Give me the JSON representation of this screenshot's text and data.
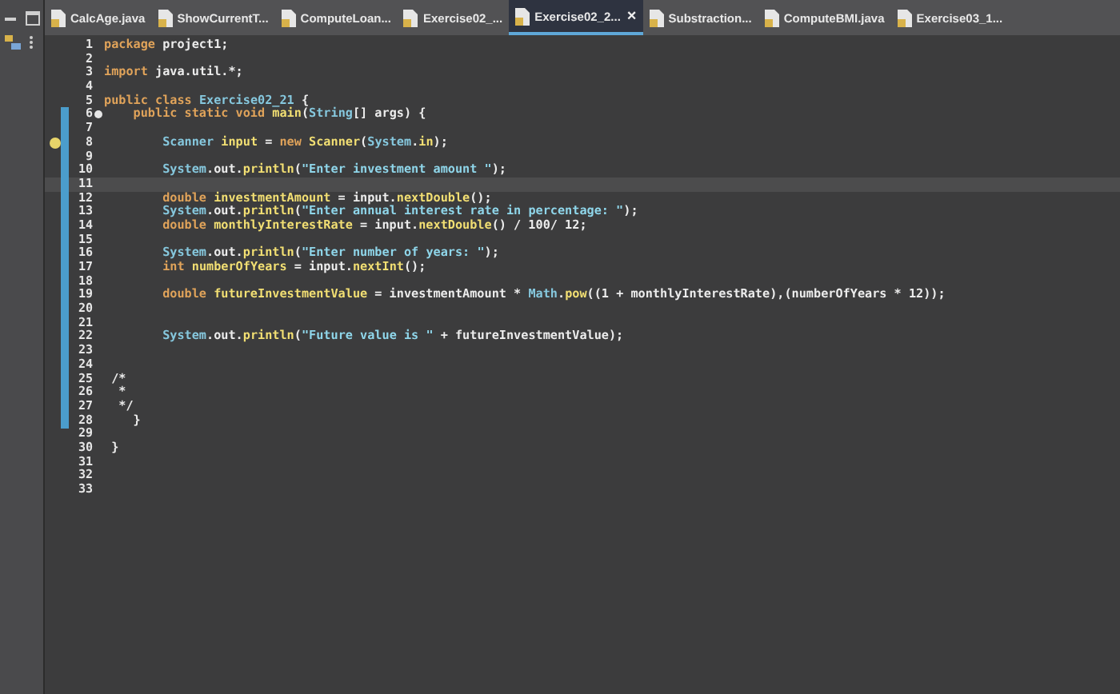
{
  "tabs": [
    {
      "label": "CalcAge.java",
      "selected": false
    },
    {
      "label": "ShowCurrentT...",
      "selected": false
    },
    {
      "label": "ComputeLoan...",
      "selected": false
    },
    {
      "label": "Exercise02_...",
      "selected": false
    },
    {
      "label": "Exercise02_2...",
      "selected": true,
      "close": "×"
    },
    {
      "label": "Substraction...",
      "selected": false
    },
    {
      "label": "ComputeBMI.java",
      "selected": false
    },
    {
      "label": "Exercise03_1...",
      "selected": false
    }
  ],
  "editor": {
    "lines": [
      {
        "number": "1",
        "tokens": [
          {
            "kind": "keyword",
            "text": "package "
          },
          {
            "kind": "plain",
            "text": "project1;"
          }
        ]
      },
      {
        "number": "2"
      },
      {
        "number": "3",
        "tokens": [
          {
            "kind": "keyword",
            "text": "import "
          },
          {
            "kind": "plain",
            "text": "java.util.*;"
          }
        ]
      },
      {
        "number": "4"
      },
      {
        "number": "5",
        "tokens": [
          {
            "kind": "keyword",
            "text": "public class "
          },
          {
            "kind": "type",
            "text": "Exercise02_21"
          },
          {
            "kind": "plain",
            "text": " {"
          }
        ]
      },
      {
        "number": "6",
        "fold": true,
        "tokens": [
          {
            "kind": "keyword",
            "text": "    public static void "
          },
          {
            "kind": "method",
            "text": "main"
          },
          {
            "kind": "plain",
            "text": "("
          },
          {
            "kind": "type",
            "text": "String"
          },
          {
            "kind": "plain",
            "text": "[] args) {"
          }
        ]
      },
      {
        "number": "7"
      },
      {
        "number": "8",
        "warning": true,
        "tokens": [
          {
            "kind": "type",
            "text": "        Scanner "
          },
          {
            "kind": "var",
            "text": "input"
          },
          {
            "kind": "plain",
            "text": " = "
          },
          {
            "kind": "keyword",
            "text": "new "
          },
          {
            "kind": "method",
            "text": "Scanner"
          },
          {
            "kind": "plain",
            "text": "("
          },
          {
            "kind": "type",
            "text": "System"
          },
          {
            "kind": "plain",
            "text": "."
          },
          {
            "kind": "var",
            "text": "in"
          },
          {
            "kind": "plain",
            "text": ");"
          }
        ]
      },
      {
        "number": "9"
      },
      {
        "number": "10",
        "tokens": [
          {
            "kind": "type",
            "text": "        System"
          },
          {
            "kind": "plain",
            "text": ".out."
          },
          {
            "kind": "method",
            "text": "println"
          },
          {
            "kind": "plain",
            "text": "("
          },
          {
            "kind": "string",
            "text": "\"Enter investment amount \""
          },
          {
            "kind": "plain",
            "text": ");"
          }
        ]
      },
      {
        "number": "11",
        "current": true
      },
      {
        "number": "12",
        "tokens": [
          {
            "kind": "keyword",
            "text": "        double "
          },
          {
            "kind": "var",
            "text": "investmentAmount"
          },
          {
            "kind": "plain",
            "text": " = input."
          },
          {
            "kind": "method",
            "text": "nextDouble"
          },
          {
            "kind": "plain",
            "text": "();"
          }
        ]
      },
      {
        "number": "13",
        "tokens": [
          {
            "kind": "type",
            "text": "        System"
          },
          {
            "kind": "plain",
            "text": ".out."
          },
          {
            "kind": "method",
            "text": "println"
          },
          {
            "kind": "plain",
            "text": "("
          },
          {
            "kind": "string",
            "text": "\"Enter annual interest rate in percentage: \""
          },
          {
            "kind": "plain",
            "text": ");"
          }
        ]
      },
      {
        "number": "14",
        "tokens": [
          {
            "kind": "keyword",
            "text": "        double "
          },
          {
            "kind": "var",
            "text": "monthlyInterestRate"
          },
          {
            "kind": "plain",
            "text": " = input."
          },
          {
            "kind": "method",
            "text": "nextDouble"
          },
          {
            "kind": "plain",
            "text": "() / 100/ 12;"
          }
        ]
      },
      {
        "number": "15"
      },
      {
        "number": "16",
        "tokens": [
          {
            "kind": "type",
            "text": "        System"
          },
          {
            "kind": "plain",
            "text": ".out."
          },
          {
            "kind": "method",
            "text": "println"
          },
          {
            "kind": "plain",
            "text": "("
          },
          {
            "kind": "string",
            "text": "\"Enter number of years: \""
          },
          {
            "kind": "plain",
            "text": ");"
          }
        ]
      },
      {
        "number": "17",
        "tokens": [
          {
            "kind": "keyword",
            "text": "        int "
          },
          {
            "kind": "var",
            "text": "numberOfYears"
          },
          {
            "kind": "plain",
            "text": " = input."
          },
          {
            "kind": "method",
            "text": "nextInt"
          },
          {
            "kind": "plain",
            "text": "();"
          }
        ]
      },
      {
        "number": "18"
      },
      {
        "number": "19",
        "tokens": [
          {
            "kind": "keyword",
            "text": "        double "
          },
          {
            "kind": "var",
            "text": "futureInvestmentValue"
          },
          {
            "kind": "plain",
            "text": " = investmentAmount * "
          },
          {
            "kind": "type",
            "text": "Math"
          },
          {
            "kind": "plain",
            "text": "."
          },
          {
            "kind": "method",
            "text": "pow"
          },
          {
            "kind": "plain",
            "text": "((1 + monthlyInterestRate),(numberOfYears * 12));"
          }
        ]
      },
      {
        "number": "20"
      },
      {
        "number": "21"
      },
      {
        "number": "22",
        "tokens": [
          {
            "kind": "type",
            "text": "        System"
          },
          {
            "kind": "plain",
            "text": ".out."
          },
          {
            "kind": "method",
            "text": "println"
          },
          {
            "kind": "plain",
            "text": "("
          },
          {
            "kind": "string",
            "text": "\"Future value is \""
          },
          {
            "kind": "plain",
            "text": " + futureInvestmentValue);"
          }
        ]
      },
      {
        "number": "23"
      },
      {
        "number": "24"
      },
      {
        "number": "25",
        "tokens": [
          {
            "kind": "plain",
            "text": " /*"
          }
        ]
      },
      {
        "number": "26",
        "tokens": [
          {
            "kind": "plain",
            "text": "  *"
          }
        ]
      },
      {
        "number": "27",
        "tokens": [
          {
            "kind": "plain",
            "text": "  */"
          }
        ]
      },
      {
        "number": "28",
        "tokens": [
          {
            "kind": "plain",
            "text": "    }"
          }
        ]
      },
      {
        "number": "29"
      },
      {
        "number": "30",
        "tokens": [
          {
            "kind": "plain",
            "text": " }"
          }
        ]
      },
      {
        "number": "31"
      },
      {
        "number": "32"
      },
      {
        "number": "33"
      }
    ]
  }
}
